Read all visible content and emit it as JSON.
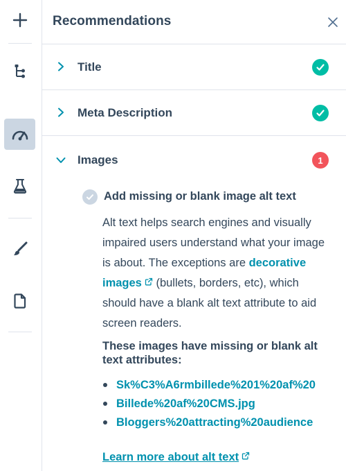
{
  "rail": {
    "icons": [
      "plus-icon",
      "structure-icon",
      "gauge-icon",
      "flask-icon",
      "brush-icon",
      "page-icon"
    ]
  },
  "panel": {
    "title": "Recommendations",
    "close_icon": "close-icon"
  },
  "sections": [
    {
      "label": "Title",
      "status": "complete",
      "chevron": "chevron-right"
    },
    {
      "label": "Meta Description",
      "status": "complete",
      "chevron": "chevron-right"
    },
    {
      "label": "Images",
      "status": "issues",
      "count": "1",
      "chevron": "chevron-down"
    }
  ],
  "recommendation": {
    "title": "Add missing or blank image alt text",
    "desc_before": "Alt text helps search engines and visually impaired users understand what your image is about. The exceptions are ",
    "desc_link": "decorative images",
    "desc_after": " (bullets, borders, etc), which should have a blank alt text attribute to aid screen readers.",
    "list_heading": "These images have missing or blank alt text attributes:",
    "images": [
      "Sk%C3%A6rmbillede%201%20af%20",
      "Billede%20af%20CMS.jpg",
      "Bloggers%20attracting%20audience"
    ],
    "learn_more": "Learn more about alt text"
  },
  "colors": {
    "success": "#00bda5",
    "alert": "#f2545b",
    "link": "#0091ae",
    "text": "#33475b",
    "border": "#dfe3eb",
    "active_rail": "#cbd6e2"
  }
}
